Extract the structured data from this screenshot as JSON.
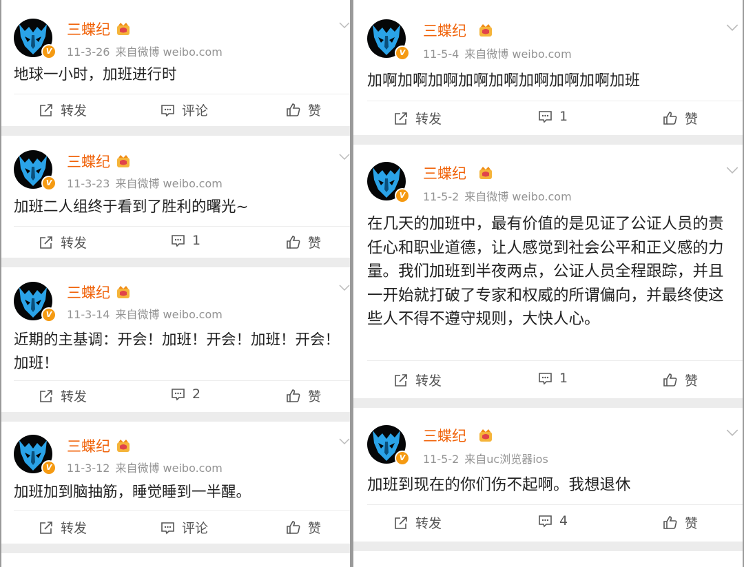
{
  "author": {
    "name": "三蝶纪",
    "verified_badge": "V"
  },
  "labels": {
    "repost": "转发",
    "comment": "评论",
    "like": "赞"
  },
  "colors": {
    "name": "#f0630a",
    "badge": "#f59a12",
    "meta": "#939393",
    "bg": "#ececec"
  },
  "icons": [
    "share-icon",
    "comment-icon",
    "thumb-up-icon",
    "chevron-down-icon",
    "crown-icon"
  ],
  "left": [
    {
      "date": "11-3-26",
      "source": "来自微博 weibo.com",
      "text": "地球一小时，加班进行时",
      "comment": "评论"
    },
    {
      "date": "11-3-23",
      "source": "来自微博 weibo.com",
      "text": "加班二人组终于看到了胜利的曙光~",
      "comment": "1"
    },
    {
      "date": "11-3-14",
      "source": "来自微博 weibo.com",
      "text": "近期的主基调：开会！加班！开会！加班！开会！加班！",
      "comment": "2"
    },
    {
      "date": "11-3-12",
      "source": "来自微博 weibo.com",
      "text": "加班加到脑抽筋，睡觉睡到一半醒。",
      "comment": "评论"
    }
  ],
  "right": [
    {
      "date": "11-5-4",
      "source": "来自微博 weibo.com",
      "text": "加啊加啊加啊加啊加啊加啊加啊加啊加班",
      "comment": "1"
    },
    {
      "date": "11-5-2",
      "source": "来自微博 weibo.com",
      "text": "在几天的加班中，最有价值的是见证了公证人员的责任心和职业道德，让人感觉到社会公平和正义感的力量。我们加班到半夜两点，公证人员全程跟踪，并且一开始就打破了专家和权威的所谓偏向，并最终使这些人不得不遵守规则，大快人心。",
      "comment": "1"
    },
    {
      "date": "11-5-2",
      "source": "来自uc浏览器ios",
      "text": "加班到现在的你们伤不起啊。我想退休",
      "comment": "4"
    }
  ]
}
